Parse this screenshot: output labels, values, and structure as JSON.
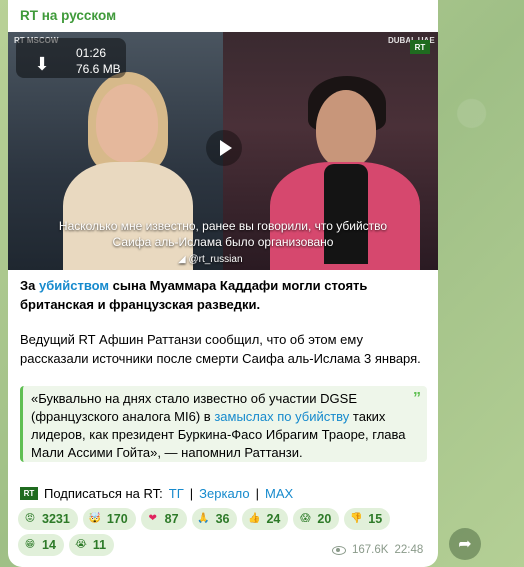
{
  "channel": {
    "name": "RT на русском"
  },
  "video": {
    "duration": "01:26",
    "filesize": "76.6 MB",
    "tag_left": "RT MSCOW",
    "tag_right": "DUBAI, UAE",
    "logo": "RT",
    "subtitle_line1": "Насколько мне известно, ранее вы говорили, что убийство",
    "subtitle_line2": "Саифа аль-Ислама было организовано",
    "watermark": "@rt_russian"
  },
  "post": {
    "lead_prefix": "За ",
    "lead_link": "убийством",
    "lead_suffix": " сына Муаммара Каддафи могли стоять британская и французская разведки.",
    "para2": "Ведущий RT Афшин Раттанзи сообщил, что об этом ему рассказали источники после смерти Саифа аль-Ислама 3 января.",
    "quote_prefix": "«Буквально на днях стало известно об участии DGSE (французского аналога MI6) в ",
    "quote_link": "замыслах по убийству",
    "quote_suffix": " таких лидеров, как президент Буркина-Фасо Ибрагим Траоре, глава Мали Ассими Гойта», — напомнил Раттанзи."
  },
  "subscribe": {
    "logo": "RT",
    "label": "Подписаться на RT: ",
    "link1": "ТГ",
    "sep1": " | ",
    "link2": "Зеркало",
    "sep2": " | ",
    "link3": "MAX"
  },
  "reactions": [
    {
      "emoji": "angry-face",
      "glyph": "😡",
      "count": "3231"
    },
    {
      "emoji": "exploding-head",
      "glyph": "🤯",
      "count": "170"
    },
    {
      "emoji": "red-heart",
      "glyph": "❤",
      "count": "87"
    },
    {
      "emoji": "folded-hands",
      "glyph": "🙏",
      "count": "36"
    },
    {
      "emoji": "thumbs-up",
      "glyph": "👍",
      "count": "24"
    },
    {
      "emoji": "screaming-face",
      "glyph": "😱",
      "count": "20"
    },
    {
      "emoji": "thumbs-down",
      "glyph": "👎",
      "count": "15"
    },
    {
      "emoji": "grinning-face",
      "glyph": "😁",
      "count": "14"
    },
    {
      "emoji": "crying-face",
      "glyph": "😭",
      "count": "11"
    }
  ],
  "meta": {
    "views": "167.6K",
    "time": "22:48"
  },
  "colors": {
    "accent": "#3f9a3a",
    "link": "#168acd",
    "reaction_bg": "#e1f0da"
  }
}
